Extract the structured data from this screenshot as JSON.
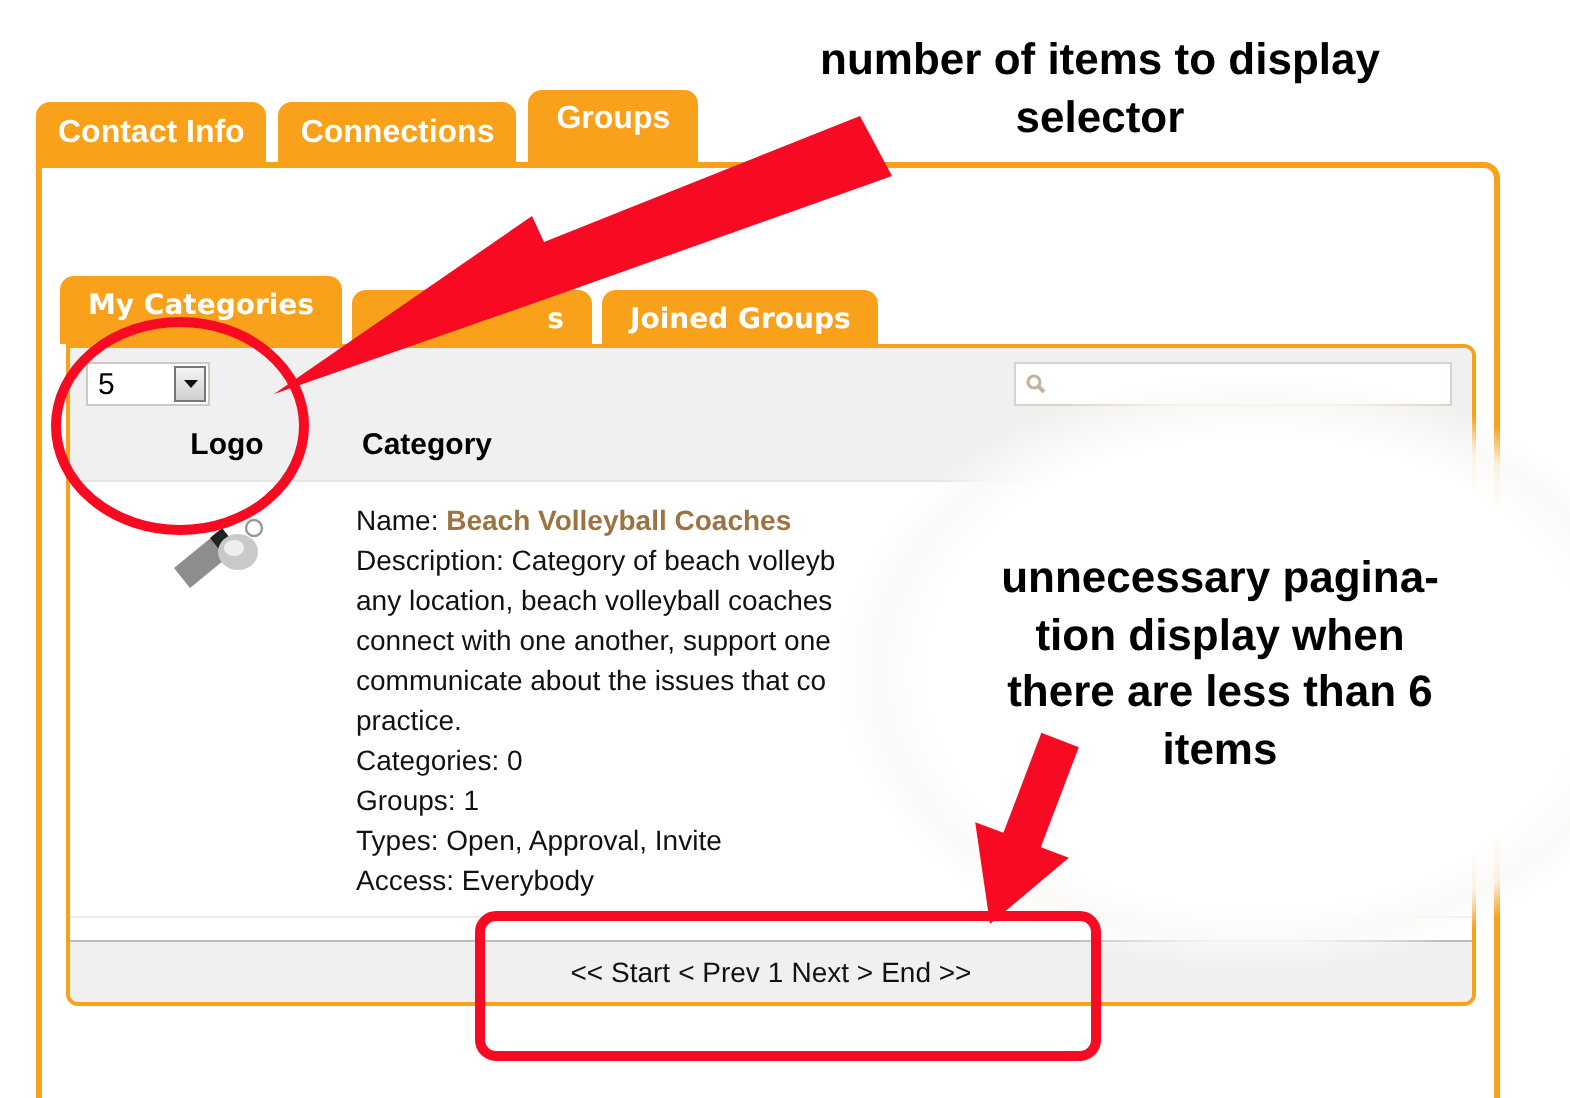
{
  "tabs": [
    {
      "label": "Contact Info",
      "selected": false
    },
    {
      "label": "Connections",
      "selected": false
    },
    {
      "label": "Groups",
      "selected": true
    }
  ],
  "subtabs": [
    {
      "label": "My Categories",
      "selected": true
    },
    {
      "label": "s",
      "selected": false
    },
    {
      "label": "Joined Groups",
      "selected": false
    }
  ],
  "page_size": {
    "value": "5"
  },
  "table": {
    "columns": [
      "Logo",
      "Category"
    ],
    "rows": [
      {
        "name_label": "Name:",
        "name": "Beach Volleyball Coaches",
        "description_lines": [
          "Description: Category of beach volleyb",
          "any location, beach volleyball coaches",
          "connect with one another, support one",
          "communicate about the issues that co",
          "practice."
        ],
        "details": [
          "Categories: 0",
          "Groups: 1",
          "Types: Open, Approval, Invite",
          "Access: Everybody"
        ]
      }
    ]
  },
  "pagination": [
    "<< Start",
    "< Prev",
    "1",
    "Next >",
    "End >>"
  ],
  "annotations": [
    {
      "lines": [
        "number of items to display",
        "selector"
      ]
    },
    {
      "lines": [
        "unnecessary pagina-",
        "tion display when",
        "there are less than 6",
        "items"
      ]
    }
  ]
}
